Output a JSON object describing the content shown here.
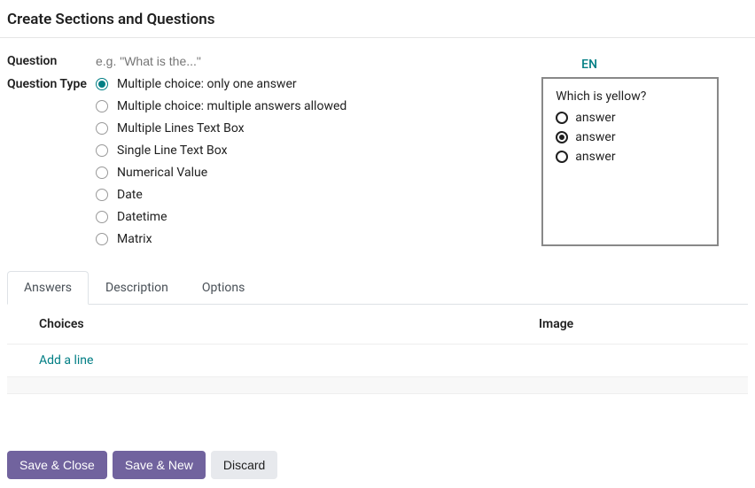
{
  "header": {
    "title": "Create Sections and Questions"
  },
  "question": {
    "label": "Question",
    "placeholder": "e.g. \"What is the...\"",
    "value": "",
    "language_badge": "EN"
  },
  "question_type": {
    "label": "Question Type",
    "options": [
      {
        "label": "Multiple choice: only one answer",
        "selected": true
      },
      {
        "label": "Multiple choice: multiple answers allowed",
        "selected": false
      },
      {
        "label": "Multiple Lines Text Box",
        "selected": false
      },
      {
        "label": "Single Line Text Box",
        "selected": false
      },
      {
        "label": "Numerical Value",
        "selected": false
      },
      {
        "label": "Date",
        "selected": false
      },
      {
        "label": "Datetime",
        "selected": false
      },
      {
        "label": "Matrix",
        "selected": false
      }
    ]
  },
  "preview": {
    "title": "Which is yellow?",
    "items": [
      {
        "label": "answer",
        "selected": false
      },
      {
        "label": "answer",
        "selected": true
      },
      {
        "label": "answer",
        "selected": false
      }
    ]
  },
  "tabs": [
    {
      "label": "Answers",
      "active": true
    },
    {
      "label": "Description",
      "active": false
    },
    {
      "label": "Options",
      "active": false
    }
  ],
  "table": {
    "headers": {
      "choices": "Choices",
      "image": "Image"
    },
    "add_line_label": "Add a line"
  },
  "footer": {
    "save_close": "Save & Close",
    "save_new": "Save & New",
    "discard": "Discard"
  }
}
